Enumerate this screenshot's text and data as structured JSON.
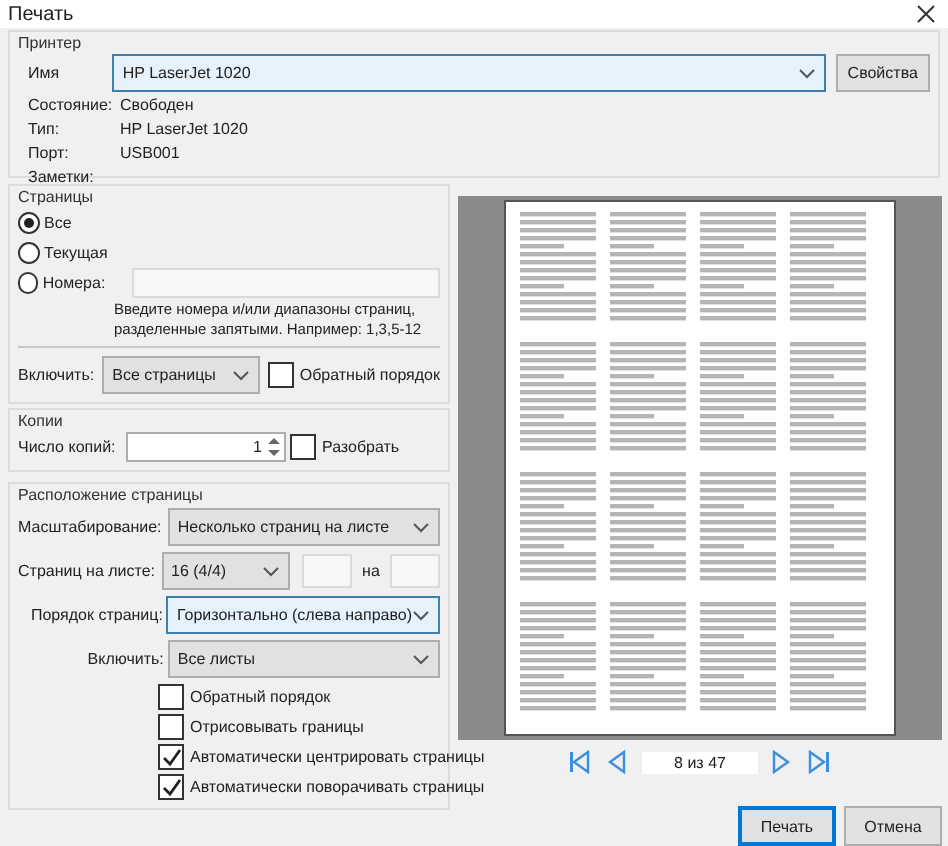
{
  "window": {
    "title": "Печать"
  },
  "printer": {
    "title": "Принтер",
    "name_label": "Имя",
    "name_value": "HP LaserJet 1020",
    "properties_button": "Свойства",
    "info": [
      {
        "label": "Состояние:",
        "value": "Свободен"
      },
      {
        "label": "Тип:",
        "value": "HP LaserJet 1020"
      },
      {
        "label": "Порт:",
        "value": "USB001"
      },
      {
        "label": "Заметки:"
      }
    ]
  },
  "pages": {
    "title": "Страницы",
    "options": [
      {
        "label": "Все",
        "selected": true
      },
      {
        "label": "Текущая",
        "selected": false
      },
      {
        "label": "Номера:",
        "selected": false
      }
    ],
    "hint": "Введите номера и/или диапазоны страниц, разделенные запятыми. Например: 1,3,5-12",
    "include_label": "Включить:",
    "include_value": "Все страницы",
    "reverse": {
      "label": "Обратный порядок",
      "checked": false
    }
  },
  "copies": {
    "title": "Копии",
    "count_label": "Число копий:",
    "count_value": "1",
    "collate": {
      "label": "Разобрать",
      "checked": false
    }
  },
  "layout": {
    "title": "Расположение страницы",
    "scaling_label": "Масштабирование:",
    "scaling_value": "Несколько страниц на листе",
    "per_sheet_label": "Страниц на листе:",
    "per_sheet_value": "16 (4/4)",
    "of_label": "на",
    "order_label": "Порядок страниц:",
    "order_value": "Горизонтально (слева направо)",
    "include_label": "Включить:",
    "include_value": "Все листы",
    "options": [
      {
        "label": "Обратный порядок",
        "checked": false
      },
      {
        "label": "Отрисовывать границы",
        "checked": false
      },
      {
        "label": "Автоматически центрировать страницы",
        "checked": true
      },
      {
        "label": "Автоматически поворачивать страницы",
        "checked": true
      }
    ]
  },
  "preview": {
    "page_indicator": "8 из 47"
  },
  "buttons": [
    {
      "label": "Печать",
      "default": true
    },
    {
      "label": "Отмена",
      "default": false
    }
  ]
}
